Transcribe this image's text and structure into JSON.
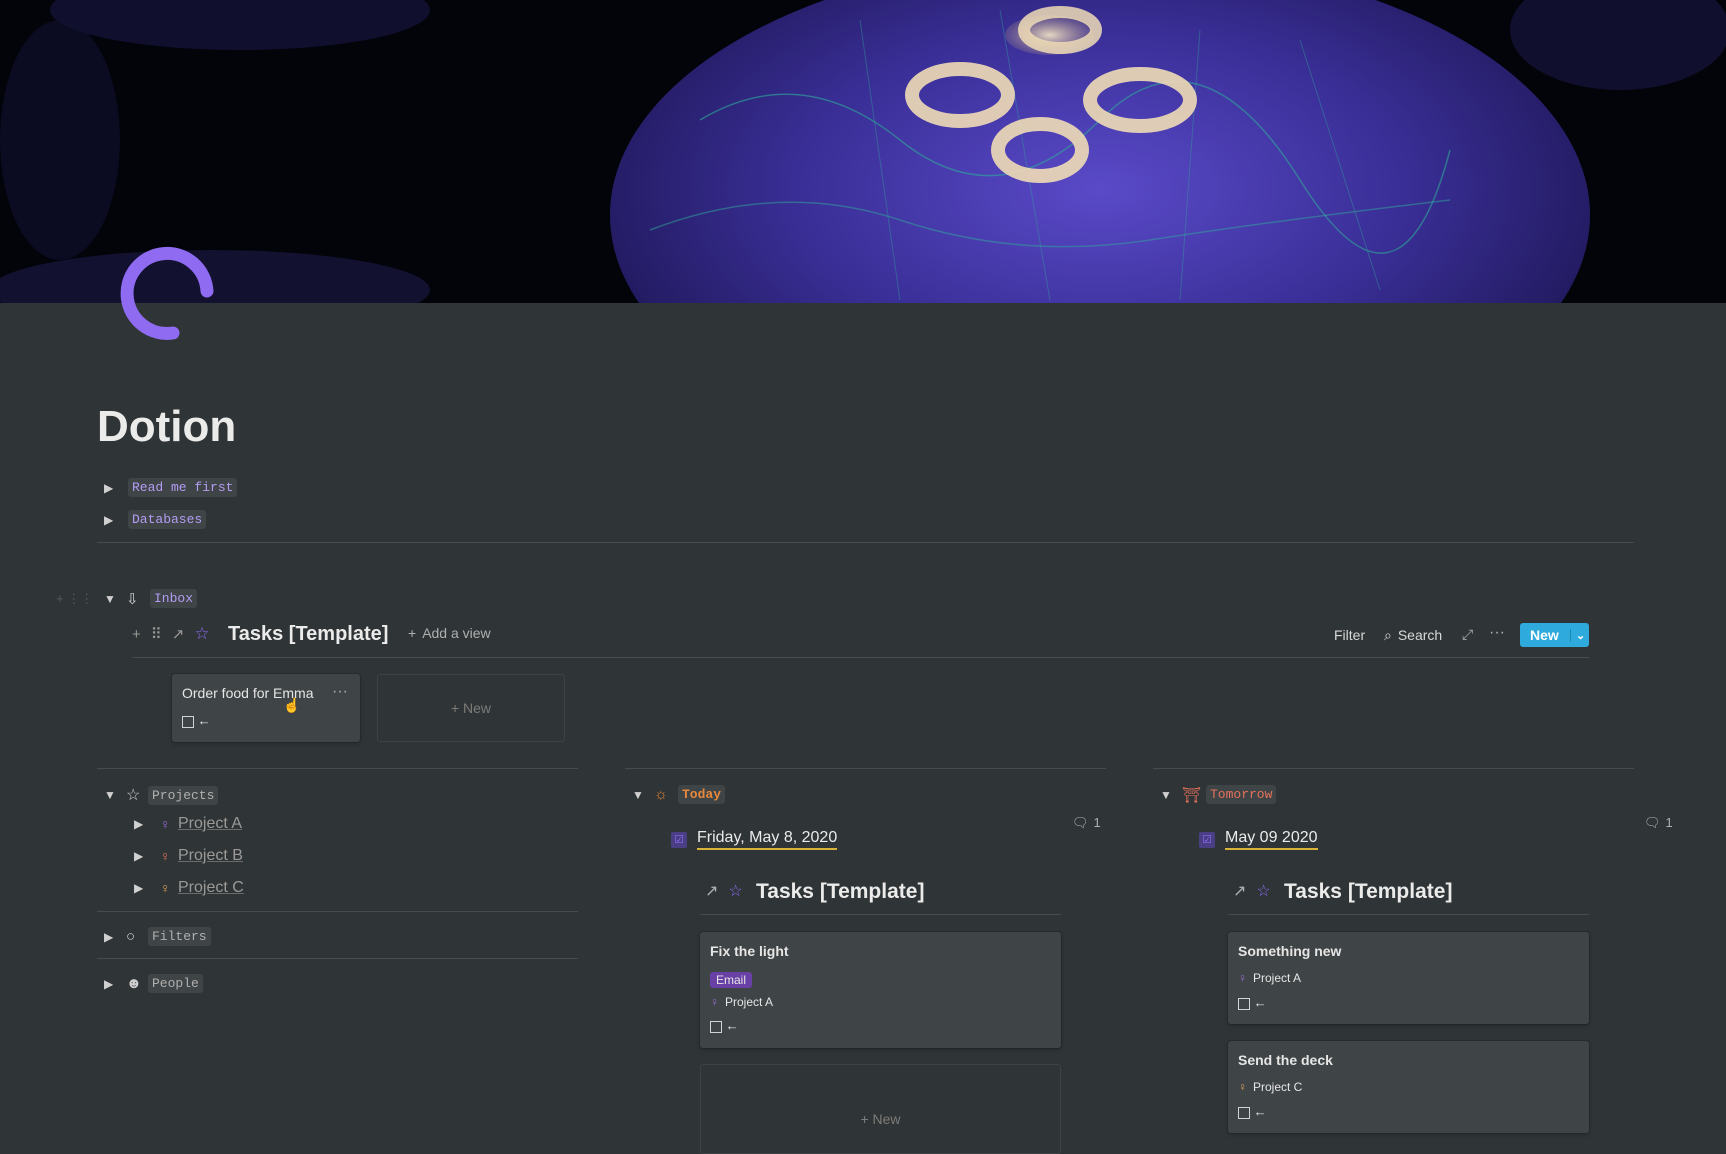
{
  "page": {
    "title": "Dotion"
  },
  "toggles": {
    "read_me": "Read me first",
    "databases": "Databases"
  },
  "inbox": {
    "label": "Inbox",
    "db_title": "Tasks [Template]",
    "add_view": "Add a view",
    "filter": "Filter",
    "search": "Search",
    "new": "New",
    "card": {
      "title": "Order food for Emma",
      "more": "···",
      "arrow": "←"
    },
    "new_card": "New"
  },
  "projects": {
    "label": "Projects",
    "items": [
      {
        "label": "Project A",
        "color": "#9a6dd7"
      },
      {
        "label": "Project B",
        "color": "#e4715a"
      },
      {
        "label": "Project C",
        "color": "#d9a05b"
      }
    ]
  },
  "filters": {
    "label": "Filters"
  },
  "people": {
    "label": "People"
  },
  "today": {
    "label": "Today",
    "date": "Friday, May 8, 2020",
    "comments": "1",
    "db_title": "Tasks [Template]",
    "card": {
      "title": "Fix the light",
      "tag": "Email",
      "project": "Project A",
      "arrow": "←"
    },
    "new_card": "New"
  },
  "tomorrow": {
    "label": "Tomorrow",
    "date": "May 09 2020",
    "comments": "1",
    "db_title": "Tasks [Template]",
    "cards": [
      {
        "title": "Something new",
        "project": "Project A",
        "arrow": "←"
      },
      {
        "title": "Send the deck",
        "project": "Project C",
        "arrow": "←"
      }
    ]
  },
  "colors": {
    "accent": "#2eaadc",
    "purple": "#8e6bf0",
    "today": "#e8883a",
    "tomorrow": "#e4715a"
  }
}
